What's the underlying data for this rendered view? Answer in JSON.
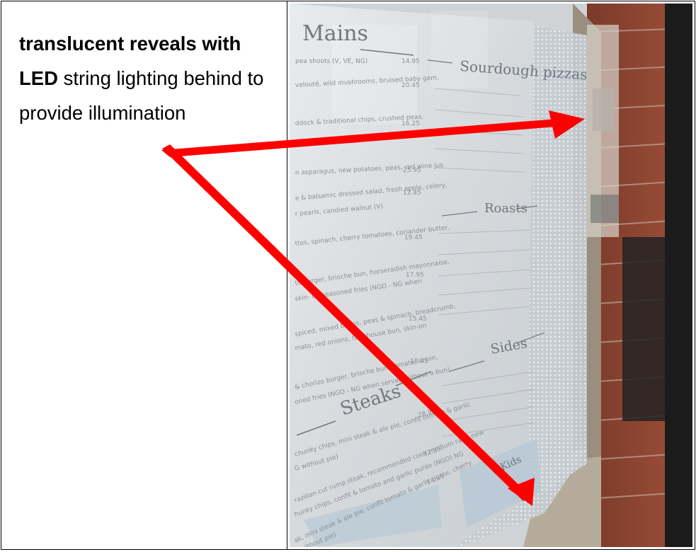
{
  "caption": {
    "bold_part": "translucent reveals with LED",
    "regular_part": " string lighting behind to provide illumination"
  },
  "photo": {
    "menu_headings": {
      "mains": "Mains",
      "pizzas": "Sourdough pizzas",
      "roasts": "Roasts",
      "sides": "Sides",
      "steaks": "Steaks",
      "kids": "Kids"
    },
    "menu_lines": [
      {
        "text": "pea shoots (V, VE, NG)",
        "price": "14.95"
      },
      {
        "text": "velouté, wild mushrooms, bruised baby gem,",
        "price": "20.45"
      },
      {
        "text": "ddock & traditional chips, crushed peas,",
        "price": "16.25"
      },
      {
        "text": "n asparagus, new potatoes, peas, red wine jus",
        "price": "25.95"
      },
      {
        "text": "e & balsamic dressed salad, fresh apple, celery,",
        "price": "12.45"
      },
      {
        "text": "r pearls, candied walnut (V)",
        "price": ""
      },
      {
        "text": "ttes, spinach, cherry tomatoes, coriander butter,",
        "price": "19.45"
      },
      {
        "text": "to burger, brioche bun, horseradish mayonnaise,",
        "price": "17.95"
      },
      {
        "text": "skin- on seasoned fries (NGO - NG when",
        "price": ""
      },
      {
        "text": "spiced, mixed beans, peas & spinach, breadcrumb,",
        "price": "15.45"
      },
      {
        "text": "mato, red onions, farmhouse bun, skin-on",
        "price": ""
      },
      {
        "text": "& chorizo burger, brioche bun, tomato, onion,",
        "price": "18.45"
      },
      {
        "text": "oned fries (NGO - NG when served without a bun)",
        "price": ""
      },
      {
        "text": "chunky chips, mini steak & ale pie, confit tomato & garlic",
        "price": "28.95"
      },
      {
        "text": "G without pie)",
        "price": ""
      },
      {
        "text": "razilian cut rump steak, recommended cook medium rare, new",
        "price": "32.95"
      },
      {
        "text": "hunky chips, confit & tomato and garlic purée (NGO) NG",
        "price": ""
      },
      {
        "text": "ak, mini steak & ale pie, confit tomato & garlic purée, cherry",
        "price": "74.95"
      },
      {
        "text": "G without pie)",
        "price": ""
      }
    ]
  },
  "annotation": {
    "arrow_color": "#ff0000"
  }
}
